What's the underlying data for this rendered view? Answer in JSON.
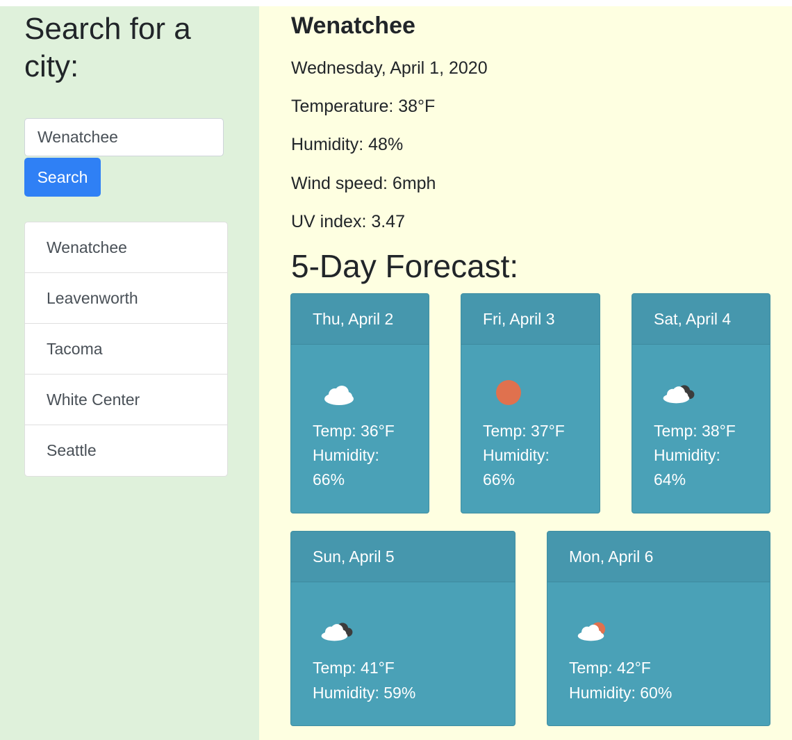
{
  "sidebar": {
    "heading": "Search for a city:",
    "search": {
      "value": "Wenatchee",
      "button_label": "Search"
    },
    "history": [
      "Wenatchee",
      "Leavenworth",
      "Tacoma",
      "White Center",
      "Seattle"
    ]
  },
  "current": {
    "city": "Wenatchee",
    "date": "Wednesday, April 1, 2020",
    "temperature": "Temperature: 38°F",
    "humidity": "Humidity: 48%",
    "wind": "Wind speed: 6mph",
    "uv": "UV index: 3.47"
  },
  "forecast": {
    "heading": "5-Day Forecast:",
    "days": [
      {
        "date": "Thu, April 2",
        "icon": "cloud-icon",
        "temp": "Temp: 36°F",
        "humidity": "Humidity: 66%"
      },
      {
        "date": "Fri, April 3",
        "icon": "sun-icon",
        "temp": "Temp: 37°F",
        "humidity": "Humidity: 66%"
      },
      {
        "date": "Sat, April 4",
        "icon": "dark-cloud-icon",
        "temp": "Temp: 38°F",
        "humidity": "Humidity: 64%"
      },
      {
        "date": "Sun, April 5",
        "icon": "dark-cloud-icon",
        "temp": "Temp: 41°F",
        "humidity": "Humidity: 59%"
      },
      {
        "date": "Mon, April 6",
        "icon": "sun-cloud-icon",
        "temp": "Temp: 42°F",
        "humidity": "Humidity: 60%"
      }
    ]
  },
  "colors": {
    "sidebar_bg": "#dff1db",
    "main_bg": "#feffe1",
    "button": "#2f80f5",
    "card": "#4aa1b7",
    "sun": "#e0714e"
  }
}
